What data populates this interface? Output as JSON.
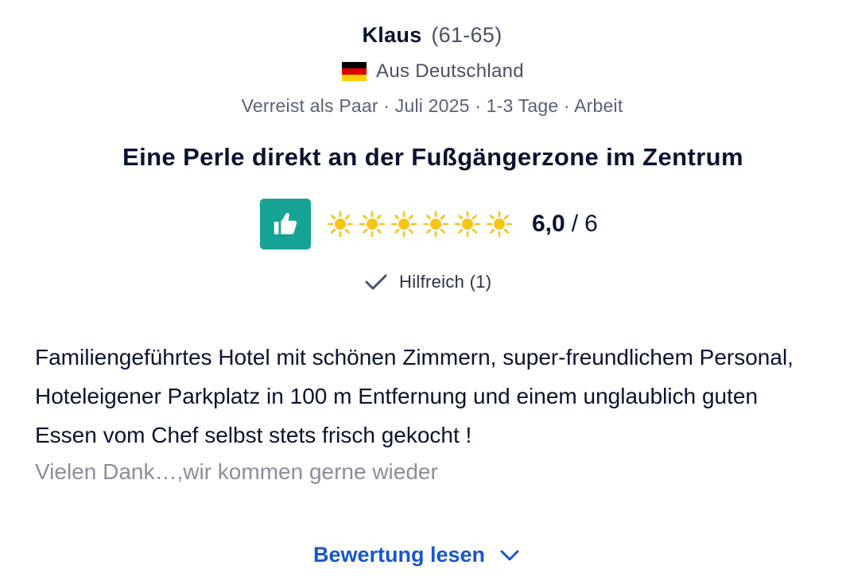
{
  "reviewer": {
    "name": "Klaus",
    "age": "(61-65)"
  },
  "origin": {
    "flag_icon": "germany-flag-icon",
    "text": "Aus Deutschland"
  },
  "meta": "Verreist als Paar · Juli 2025 · 1-3 Tage · Arbeit",
  "title": "Eine Perle direkt an der Fußgängerzone im Zentrum",
  "rating": {
    "thumb_icon": "thumbs-up-icon",
    "thumb_color": "#17a394",
    "sun_icon": "sun-icon",
    "sun_color": "#f5c518",
    "suns_filled": 6,
    "suns_total": 6,
    "score": "6,0",
    "separator": "/",
    "max": "6"
  },
  "helpful": {
    "icon": "checkmark-icon",
    "label": "Hilfreich (1)"
  },
  "review": {
    "text": "Familiengeführtes Hotel mit schönen Zimmern, super-freundlichem Personal, Hoteleigener Parkplatz in 100 m Entfernung und einem unglaublich guten Essen vom Chef selbst stets frisch gekocht !",
    "continuation": "Vielen Dank…,wir kommen gerne wieder"
  },
  "read_more": {
    "label": "Bewertung lesen",
    "icon": "chevron-down-icon",
    "color": "#1758c9"
  }
}
